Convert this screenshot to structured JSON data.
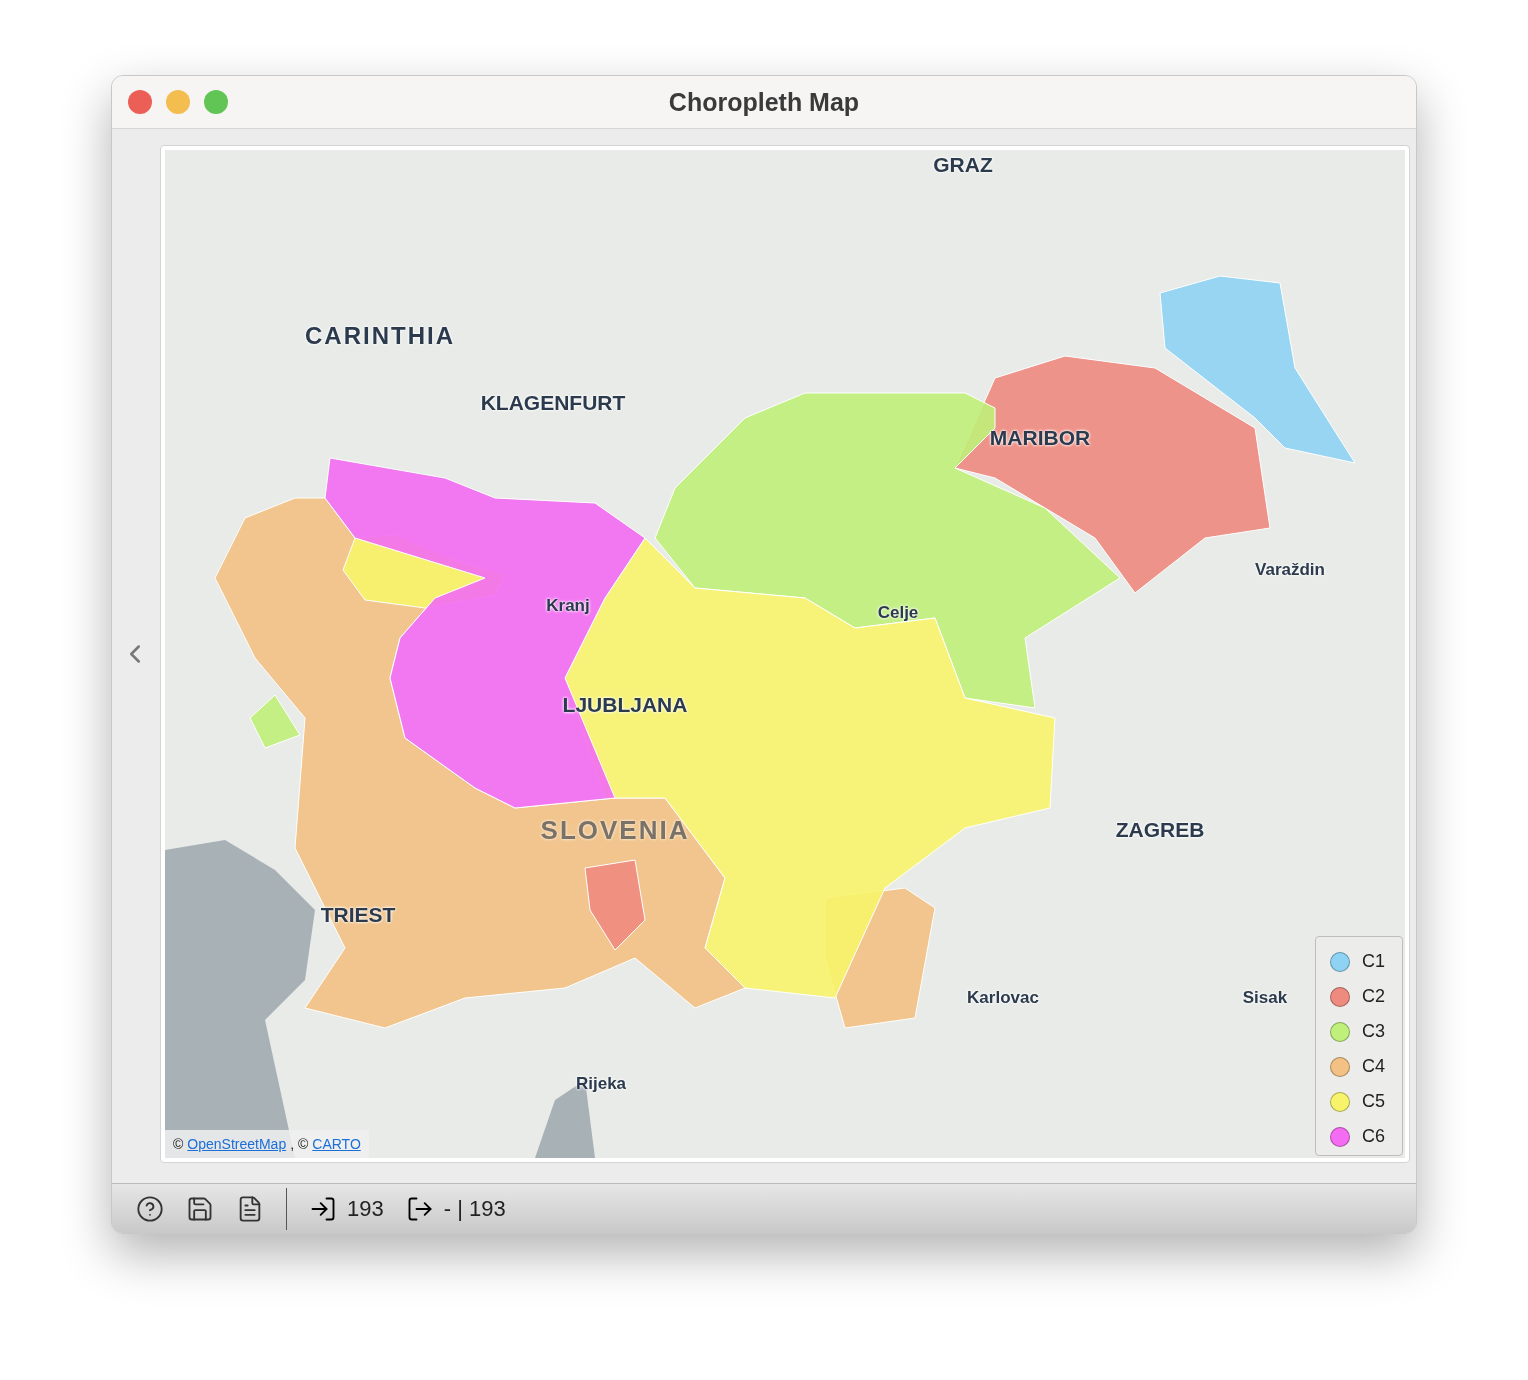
{
  "window": {
    "title": "Choropleth Map"
  },
  "map": {
    "labels": [
      {
        "text": "GRAZ",
        "kind": "city"
      },
      {
        "text": "CARINTHIA",
        "kind": "region"
      },
      {
        "text": "KLAGENFURT",
        "kind": "city"
      },
      {
        "text": "MARIBOR",
        "kind": "city"
      },
      {
        "text": "Varaždin",
        "kind": "town"
      },
      {
        "text": "Kranj",
        "kind": "town"
      },
      {
        "text": "Celje",
        "kind": "town"
      },
      {
        "text": "LJUBLJANA",
        "kind": "city"
      },
      {
        "text": "SLOVENIA",
        "kind": "country"
      },
      {
        "text": "ZAGREB",
        "kind": "city"
      },
      {
        "text": "TRIEST",
        "kind": "city"
      },
      {
        "text": "Karlovac",
        "kind": "town"
      },
      {
        "text": "Sisak",
        "kind": "town"
      },
      {
        "text": "Rijeka",
        "kind": "town"
      }
    ],
    "attribution": {
      "prefix": "©",
      "links": [
        "OpenStreetMap",
        "CARTO"
      ],
      "separator": ", ©"
    },
    "legend": [
      {
        "label": "C1",
        "color": "#8fd3f4"
      },
      {
        "label": "C2",
        "color": "#ee8a7e"
      },
      {
        "label": "C3",
        "color": "#bff07a"
      },
      {
        "label": "C4",
        "color": "#f2c183"
      },
      {
        "label": "C5",
        "color": "#f7f46c"
      },
      {
        "label": "C6",
        "color": "#f36cf2"
      }
    ]
  },
  "status_bar": {
    "input_count": "193",
    "output_count": "- | 193"
  }
}
